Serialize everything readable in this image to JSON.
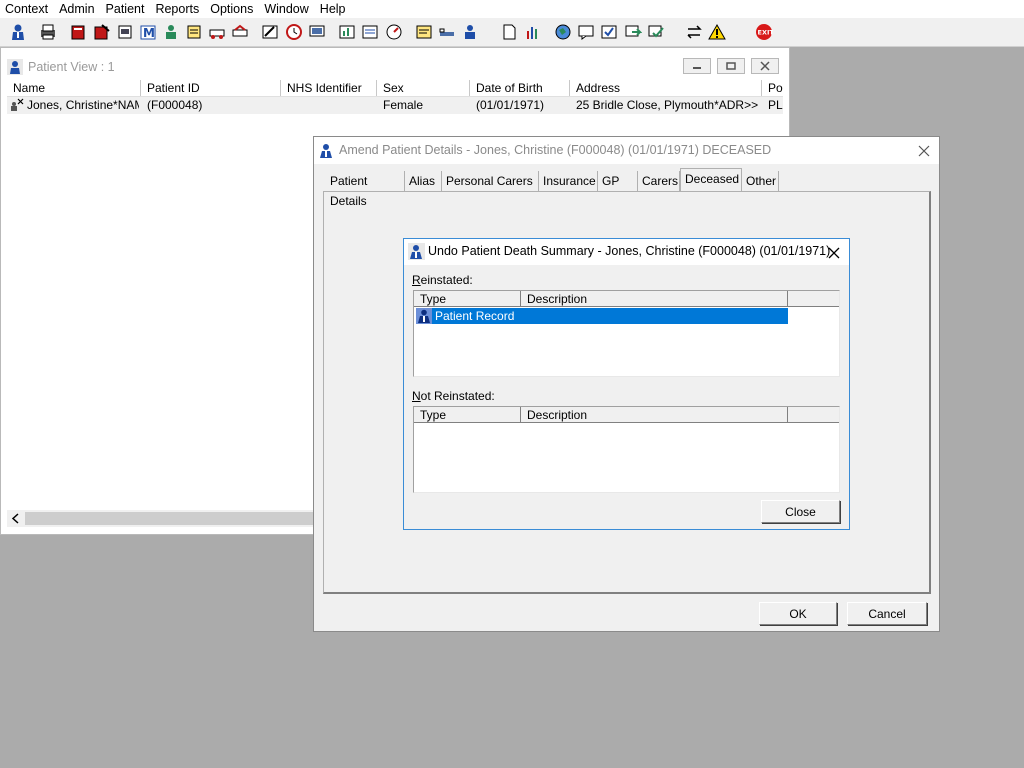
{
  "menu": [
    "Context",
    "Admin",
    "Patient",
    "Reports",
    "Options",
    "Window",
    "Help"
  ],
  "toolbar_icons": [
    "patient-search-icon",
    "print-icon",
    "book-icon",
    "open-record-icon",
    "document-icon",
    "mail-icon",
    "clinician-icon",
    "notes-icon",
    "transport-icon",
    "referral-icon",
    "edit-icon",
    "clock-icon",
    "monitor-icon",
    "chart-icon",
    "report-icon",
    "gauge-icon",
    "letter-icon",
    "bed-icon",
    "user-icon",
    "page-icon",
    "bar-chart-icon",
    "globe-icon",
    "message-icon",
    "check-in-icon",
    "green-arrow-icon",
    "green-check-icon",
    "transfer-icon",
    "warning-icon",
    "exit-icon"
  ],
  "patient_view": {
    "title": "Patient View : 1",
    "columns": [
      "Name",
      "Patient ID",
      "NHS Identifier",
      "Sex",
      "Date of Birth",
      "Address",
      "Po"
    ],
    "rows": [
      {
        "name": "Jones, Christine*NAM...",
        "patient_id": "(F000048)",
        "nhs_identifier": "",
        "sex": "Female",
        "dob": "(01/01/1971)",
        "address": "25 Bridle Close, Plymouth*ADR>>",
        "po": "PL"
      }
    ]
  },
  "amend_dialog": {
    "title": "Amend Patient Details - Jones, Christine (F000048) (01/01/1971) DECEASED",
    "tabs": [
      "Patient Details",
      "Alias",
      "Personal Carers",
      "Insurance",
      "GP",
      "Carers",
      "Deceased",
      "Other"
    ],
    "active_tab": "Deceased",
    "ok_label": "OK",
    "cancel_label": "Cancel"
  },
  "undo_dialog": {
    "title": "Undo Patient Death Summary - Jones, Christine (F000048) (01/01/1971)",
    "reinstated_first": "R",
    "reinstated_rest": "einstated:",
    "not_reinstated_first": "N",
    "not_reinstated_rest": "ot Reinstated:",
    "columns": [
      "Type",
      "Description"
    ],
    "reinstated_items": [
      {
        "type": "Patient Record",
        "description": ""
      }
    ],
    "close_label": "Close"
  },
  "colors": {
    "selection": "#0078d7",
    "desktop": "#ababab",
    "dialog_bg": "#f0f0f0",
    "undo_border": "#3a8cd6"
  }
}
